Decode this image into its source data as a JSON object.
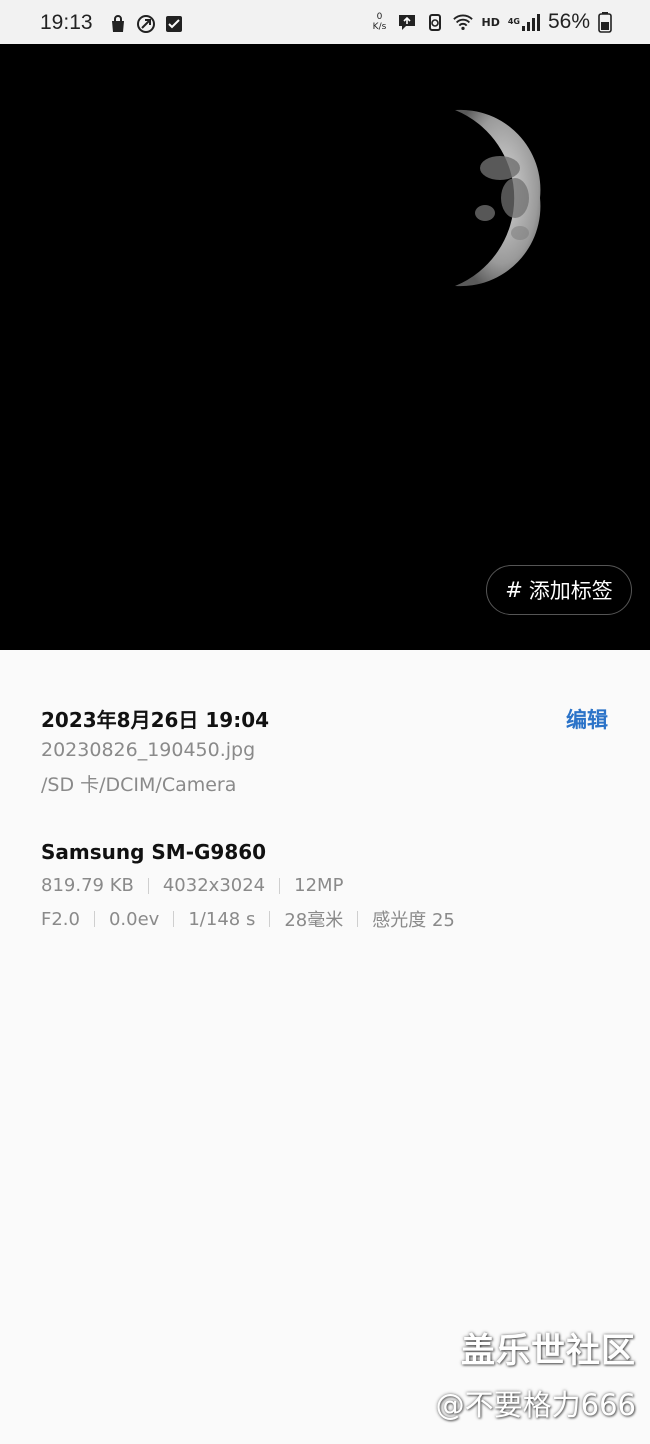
{
  "status_bar": {
    "time": "19:13",
    "net_speed_value": "0",
    "net_speed_unit": "K/s",
    "hd_label": "HD",
    "network_label": "4G",
    "battery_percent": "56%",
    "left_icons": [
      "shopping-bag-icon",
      "rocket-icon",
      "checkbox-icon"
    ],
    "right_icons": [
      "chat-upload-icon",
      "recycle-icon",
      "wifi-icon",
      "signal-icon",
      "battery-icon"
    ]
  },
  "photo": {
    "tag_button_hash": "#",
    "tag_button_label": "添加标签"
  },
  "details": {
    "date_time": "2023年8月26日 19:04",
    "edit_label": "编辑",
    "file_name": "20230826_190450.jpg",
    "file_path": "/SD 卡/DCIM/Camera",
    "device": "Samsung SM-G9860",
    "meta_row1": [
      "819.79 KB",
      "4032x3024",
      "12MP"
    ],
    "meta_row2": [
      "F2.0",
      "0.0ev",
      "1/148 s",
      "28毫米",
      "感光度 25"
    ],
    "accent_color": "#2b73c8"
  },
  "watermark": {
    "line1": "盖乐世社区",
    "line2": "@不要格力666"
  }
}
